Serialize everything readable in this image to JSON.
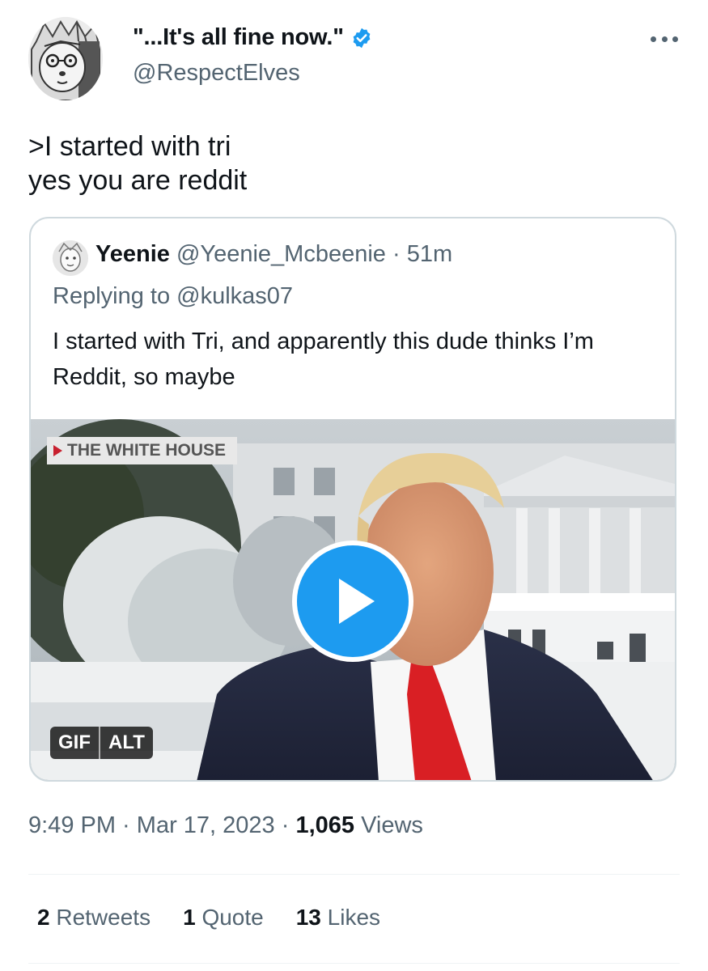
{
  "author": {
    "display_name": "\"...It's all fine now.\"",
    "handle": "@RespectElves",
    "verified": true,
    "icons": {
      "verified": "verified-badge-icon",
      "more": "more-options-icon"
    }
  },
  "tweet": {
    "text": ">I started with tri\nyes you are reddit"
  },
  "quoted": {
    "name": "Yeenie",
    "handle": "@Yeenie_Mcbeenie",
    "separator": " · ",
    "time": "51m",
    "replying_to": "Replying to @kulkas07",
    "text": "I started with Tri, and apparently this dude thinks I’m Reddit, so maybe",
    "media": {
      "chyron": "THE WHITE HOUSE",
      "badge_gif": "GIF",
      "badge_alt": "ALT",
      "play_icon": "play-icon"
    }
  },
  "meta": {
    "time": "9:49 PM",
    "separator": " · ",
    "date": "Mar 17, 2023",
    "views_count": "1,065",
    "views_label": "Views"
  },
  "stats": {
    "retweets_count": "2",
    "retweets_label": "Retweets",
    "quotes_count": "1",
    "quotes_label": "Quote",
    "likes_count": "13",
    "likes_label": "Likes"
  },
  "colors": {
    "accent": "#1d9bf0",
    "secondary_text": "#536471",
    "border": "#cfd9de"
  }
}
